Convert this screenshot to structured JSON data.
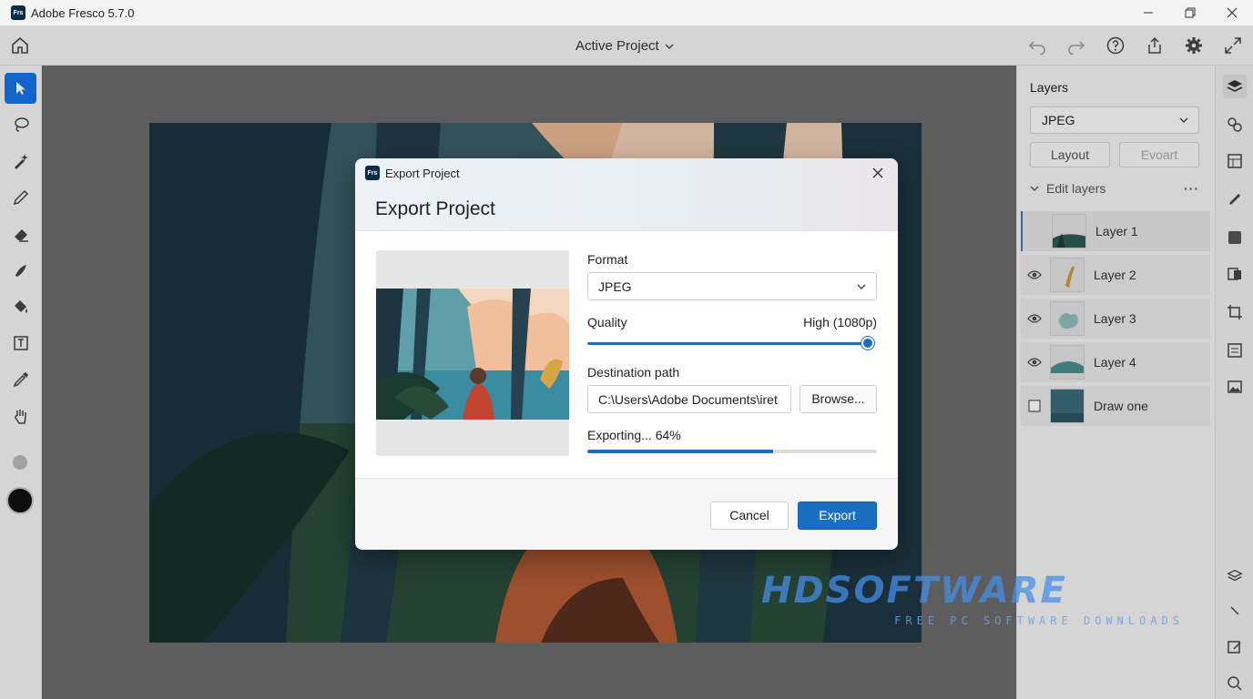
{
  "window": {
    "app_title": "Adobe Fresco 5.7.0",
    "logo_text": "Frs"
  },
  "toolbar": {
    "project_title": "Active Project"
  },
  "layers_panel": {
    "title": "Layers",
    "format_value": "JPEG",
    "layout_label": "Layout",
    "export_label": "Evoart",
    "edit_layers_label": "Edit layers",
    "layers": [
      {
        "name": "Layer 1",
        "visible": true,
        "selected": true
      },
      {
        "name": "Layer 2",
        "visible": true,
        "selected": false
      },
      {
        "name": "Layer 3",
        "visible": true,
        "selected": false
      },
      {
        "name": "Layer 4",
        "visible": true,
        "selected": false
      },
      {
        "name": "Draw one",
        "visible": false,
        "selected": false
      }
    ]
  },
  "dialog": {
    "caption": "Export Project",
    "title": "Export Project",
    "format_label": "Format",
    "format_value": "JPEG",
    "quality_label": "Quality",
    "quality_value": "High (1080p)",
    "quality_level": 1.0,
    "destination_label": "Destination path",
    "destination_value": "C:\\Users\\Adobe Documents\\iret",
    "browse_label": "Browse...",
    "progress_label": "Exporting... 64%",
    "progress_percent": 64,
    "cancel_label": "Cancel",
    "export_label": "Export"
  },
  "watermark": {
    "main": "HDSOFTWARE",
    "sub": "FREE PC SOFTWARE DOWNLOADS"
  },
  "colors": {
    "accent": "#1a6fc0",
    "active_tool": "#1473e6"
  }
}
